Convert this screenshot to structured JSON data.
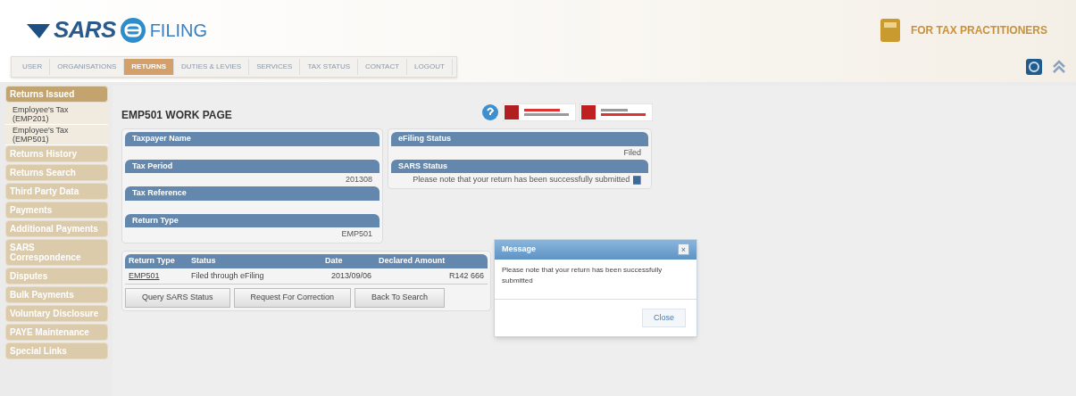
{
  "header": {
    "logo_text": "SARS",
    "logo_sub": "FILING",
    "practitioner": "FOR TAX PRACTITIONERS"
  },
  "tabs": [
    {
      "label": "USER",
      "selected": false
    },
    {
      "label": "ORGANISATIONS",
      "selected": false
    },
    {
      "label": "RETURNS",
      "selected": true
    },
    {
      "label": "DUTIES & LEVIES",
      "selected": false
    },
    {
      "label": "SERVICES",
      "selected": false
    },
    {
      "label": "TAX STATUS",
      "selected": false
    },
    {
      "label": "CONTACT",
      "selected": false
    },
    {
      "label": "LOGOUT",
      "selected": false
    }
  ],
  "sidebar": {
    "items": [
      {
        "label": "Returns Issued",
        "selected": true,
        "children": [
          {
            "label": "Employee's Tax (EMP201)"
          },
          {
            "label": "Employee's Tax (EMP501)"
          }
        ]
      },
      {
        "label": "Returns History",
        "selected": false
      },
      {
        "label": "Returns Search",
        "selected": false
      },
      {
        "label": "Third Party Data",
        "selected": false
      },
      {
        "label": "Payments",
        "selected": false
      },
      {
        "label": "Additional Payments",
        "selected": false
      },
      {
        "label": "SARS Correspondence",
        "selected": false
      },
      {
        "label": "Disputes",
        "selected": false
      },
      {
        "label": "Bulk Payments",
        "selected": false
      },
      {
        "label": "Voluntary Disclosure",
        "selected": false
      },
      {
        "label": "PAYE Maintenance",
        "selected": false
      },
      {
        "label": "Special Links",
        "selected": false
      }
    ]
  },
  "page_title": "EMP501 WORK PAGE",
  "left_fields": [
    {
      "label": "Taxpayer Name"
    },
    {
      "label": "Tax Period",
      "value": "201308"
    },
    {
      "label": "Tax Reference"
    },
    {
      "label": "Return Type",
      "value": "EMP501"
    }
  ],
  "right_fields": [
    {
      "label": "eFiling Status",
      "value": "Filed"
    },
    {
      "label": "SARS Status",
      "value": "Please note that your return has been successfully submitted"
    }
  ],
  "table": {
    "columns": [
      "Return Type",
      "Status",
      "Date",
      "Declared Amount"
    ],
    "rows": [
      [
        "EMP501",
        "Filed through eFiling",
        "2013/09/06",
        "R142 666"
      ]
    ]
  },
  "buttons": [
    "Query SARS Status",
    "Request For Correction",
    "Back To Search"
  ],
  "dialog": {
    "title": "Message",
    "close_glyph": "×",
    "message": "Please note that your return has been successfully submitted",
    "button": "Close"
  }
}
